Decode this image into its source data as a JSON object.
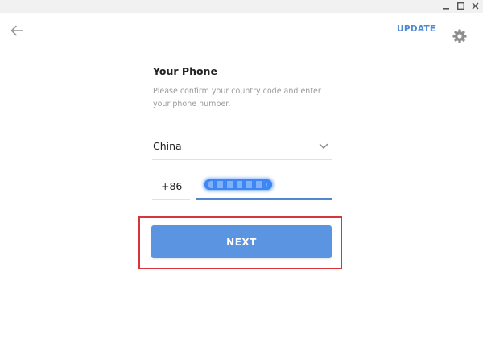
{
  "header": {
    "update_label": "UPDATE",
    "back_icon": "arrow-left-icon",
    "settings_icon": "gear-icon"
  },
  "window_controls": {
    "minimize_icon": "minimize-icon",
    "maximize_icon": "maximize-icon",
    "close_icon": "close-icon"
  },
  "form": {
    "title": "Your Phone",
    "subtitle": "Please confirm your country code and enter your phone number.",
    "country": {
      "value": "China",
      "icon": "chevron-down-icon"
    },
    "country_code": "+86",
    "phone_number": {
      "redacted": true
    },
    "next_label": "NEXT"
  },
  "colors": {
    "accent": "#4f8ad1",
    "button": "#5b95e2",
    "highlight": "#d9343a"
  }
}
